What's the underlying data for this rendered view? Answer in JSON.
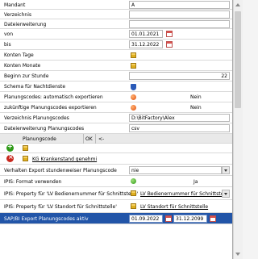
{
  "rows": {
    "mandant": {
      "label": "Mandant",
      "value": "A"
    },
    "verzeichnis": {
      "label": "Verzeichnis",
      "value": ""
    },
    "dateierweiterung": {
      "label": "Dateierweiterung",
      "value": ""
    },
    "von": {
      "label": "von",
      "value": "01.01.2021"
    },
    "bis": {
      "label": "bis",
      "value": "31.12.2022"
    },
    "konten_tage": {
      "label": "Konten Tage"
    },
    "konten_monate": {
      "label": "Konten Monate"
    },
    "beginn_stunde": {
      "label": "Beginn zur Stunde",
      "value": "22"
    },
    "schema_nachtdienste": {
      "label": "Schema für Nachtdienste"
    },
    "planungscodes_auto": {
      "label": "Planungscodes: automatisch exportieren",
      "value": "Nein"
    },
    "zukuenftige": {
      "label": "zukünftige Planungscodes exportieren",
      "value": "Nein"
    },
    "verzeichnis_planungscodes": {
      "label": "Verzeichnis Planungscodes",
      "value": "D:\\BitFactory\\Alex"
    },
    "dateierweiterung_planungscodes": {
      "label": "Dateierweiterung Planungscodes",
      "value": "csv"
    },
    "subgrid": {
      "col_planungscode": "Planungscode",
      "col_ok": "OK",
      "col_arrow": "<-",
      "entry_link": "KG Krankenstand genehmi"
    },
    "verhalten_export": {
      "label": "Verhalten Export stundenweiser Planungscode",
      "value": "nie"
    },
    "ipis_format": {
      "label": "IPIS: Format verwenden",
      "value": "Ja"
    },
    "ipis_bediener": {
      "label": "IPIS: Property für 'LV Bedienernummer für Schnittstelle'",
      "value": "LV Bedienernummer für Schnittstelle"
    },
    "ipis_standort": {
      "label": "IPIS: Property für 'LV Standort für Schnittstelle'",
      "value": "LV Standort für Schnittstelle"
    },
    "sap_export": {
      "label": "SAP/BI Export Planungscodes aktiv",
      "from": "01.09.2022",
      "to": "31.12.2099"
    }
  },
  "colors": {
    "selected_row": "#2255a8",
    "grid_border": "#d9d9d9"
  }
}
